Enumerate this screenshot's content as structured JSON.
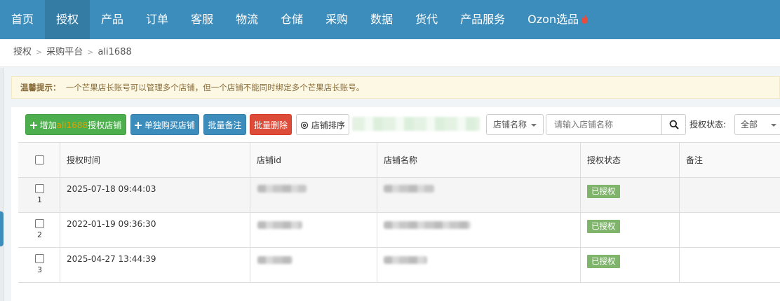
{
  "nav": {
    "items": [
      "首页",
      "授权",
      "产品",
      "订单",
      "客服",
      "物流",
      "仓储",
      "采购",
      "数据",
      "货代",
      "产品服务",
      "Ozon选品"
    ],
    "active": "授权"
  },
  "breadcrumb": [
    "授权",
    "采购平台",
    "ali1688"
  ],
  "tip": {
    "label": "温馨提示：",
    "text": "一个芒果店长账号可以管理多个店铺，但一个店铺不能同时绑定多个芒果店长账号。"
  },
  "toolbar": {
    "add_prefix": "增加",
    "add_platform": "ali1688",
    "add_suffix": "授权店铺",
    "buy_label": "单独购买店铺",
    "batch_note_label": "批量备注",
    "batch_delete_label": "批量删除",
    "sort_label": "店铺排序",
    "search_field": "店铺名称",
    "search_placeholder": "请输入店铺名称",
    "status_label": "授权状态:",
    "status_value": "全部"
  },
  "table": {
    "columns": [
      "授权时间",
      "店铺id",
      "店铺名称",
      "授权状态",
      "备注"
    ],
    "rows": [
      {
        "num": "1",
        "time": "2025-07-18 09:44:03",
        "status": "已授权"
      },
      {
        "num": "2",
        "time": "2022-01-19 09:36:30",
        "status": "已授权"
      },
      {
        "num": "3",
        "time": "2025-04-27 13:44:39",
        "status": "已授权"
      }
    ]
  },
  "colors": {
    "nav_bg": "#3c8dbc",
    "nav_active": "#357ca5",
    "success": "#4cae4c",
    "primary": "#3c8dbc",
    "danger": "#dd4b39",
    "badge": "#7fb56b"
  }
}
